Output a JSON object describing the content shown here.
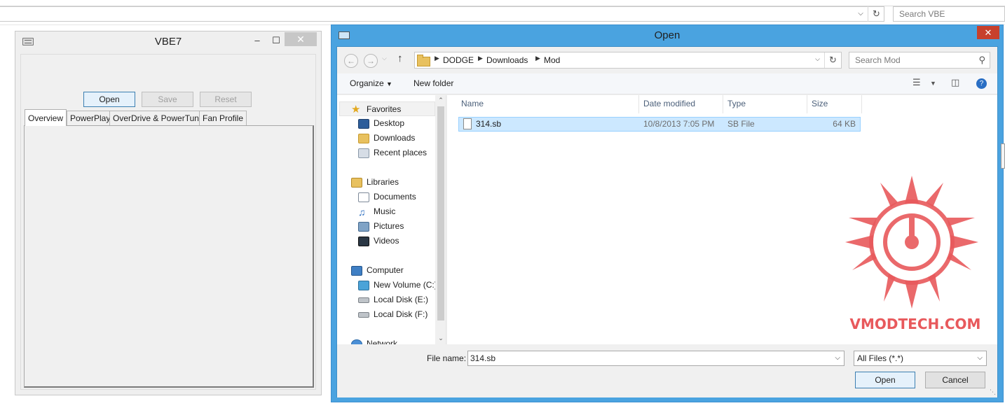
{
  "browser": {
    "search_placeholder": "Search VBE"
  },
  "vbe": {
    "title": "VBE7",
    "buttons": {
      "open": "Open",
      "save": "Save",
      "reset": "Reset"
    },
    "tabs": [
      "Overview",
      "PowerPlay",
      "OverDrive & PowerTune",
      "Fan Profile"
    ],
    "active_tab": "Overview",
    "minimize_glyph": "–",
    "maximize_glyph": "☐",
    "close_glyph": "✕"
  },
  "dialog": {
    "title": "Open",
    "close_glyph": "✕",
    "breadcrumb": [
      "DODGE",
      "Downloads",
      "Mod"
    ],
    "search_placeholder": "Search Mod",
    "toolbar": {
      "organize": "Organize",
      "new_folder": "New folder"
    },
    "nav": {
      "favorites": "Favorites",
      "desktop": "Desktop",
      "downloads": "Downloads",
      "recent": "Recent places",
      "libraries": "Libraries",
      "documents": "Documents",
      "music": "Music",
      "pictures": "Pictures",
      "videos": "Videos",
      "computer": "Computer",
      "drive_c": "New Volume (C:)",
      "drive_e": "Local Disk (E:)",
      "drive_f": "Local Disk (F:)",
      "network": "Network"
    },
    "columns": {
      "name": "Name",
      "date": "Date modified",
      "type": "Type",
      "size": "Size"
    },
    "files": [
      {
        "name": "314.sb",
        "date": "10/8/2013 7:05 PM",
        "type": "SB File",
        "size": "64 KB"
      }
    ],
    "file_name_label": "File name:",
    "file_name_value": "314.sb",
    "file_type": "All Files (*.*)",
    "open_button": "Open",
    "cancel_button": "Cancel"
  },
  "watermark": "VMODTECH.COM",
  "colors": {
    "titlebar": "#4aa3e0",
    "close_red": "#c7402c",
    "selection": "#cce8ff",
    "watermark": "#e8595c"
  }
}
